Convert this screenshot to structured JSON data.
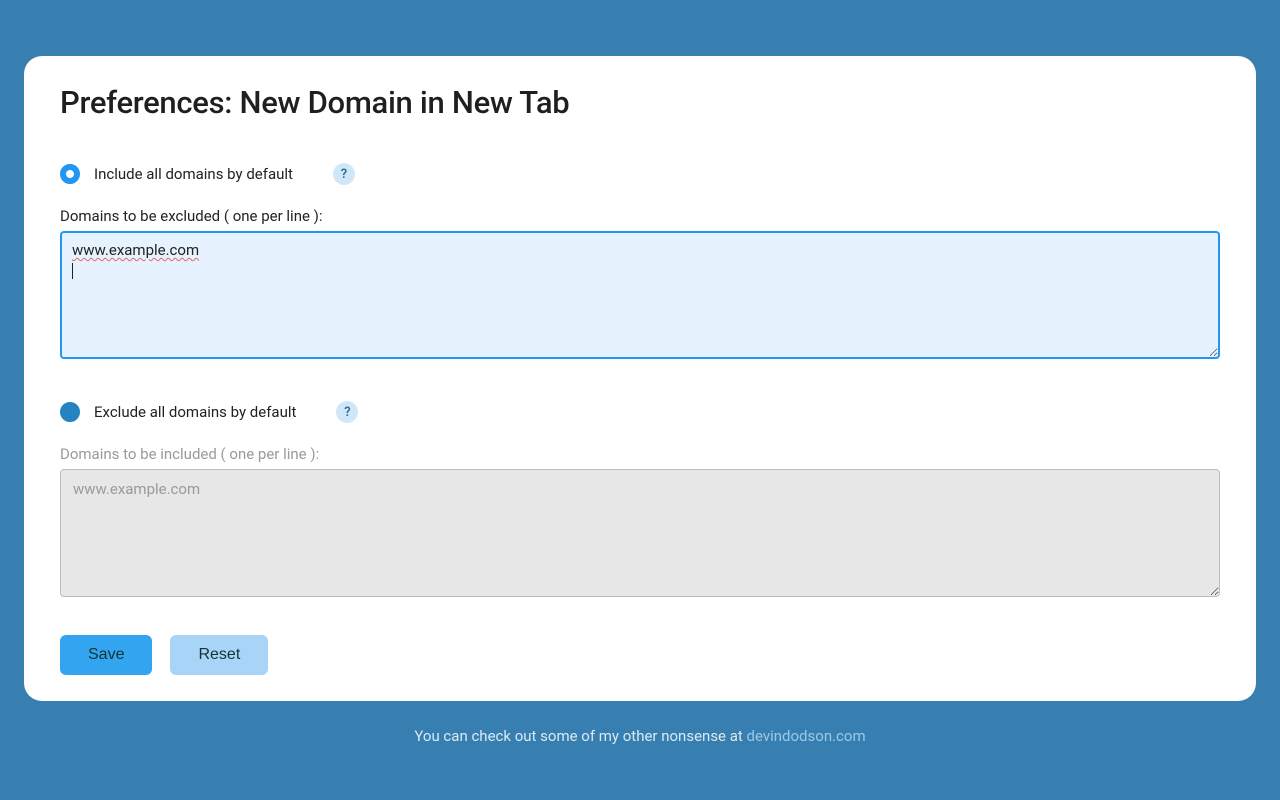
{
  "title": "Preferences: New Domain in New Tab",
  "opt1": {
    "label": "Include all domains by default",
    "help": "?",
    "field_label": "Domains to be excluded ( one per line ):",
    "value": "www.example.com"
  },
  "opt2": {
    "label": "Exclude all domains by default",
    "help": "?",
    "field_label": "Domains to be included ( one per line ):",
    "placeholder": "www.example.com"
  },
  "buttons": {
    "save": "Save",
    "reset": "Reset"
  },
  "footer": {
    "prefix": "You can check out some of my other nonsense at ",
    "link": "devindodson.com"
  }
}
